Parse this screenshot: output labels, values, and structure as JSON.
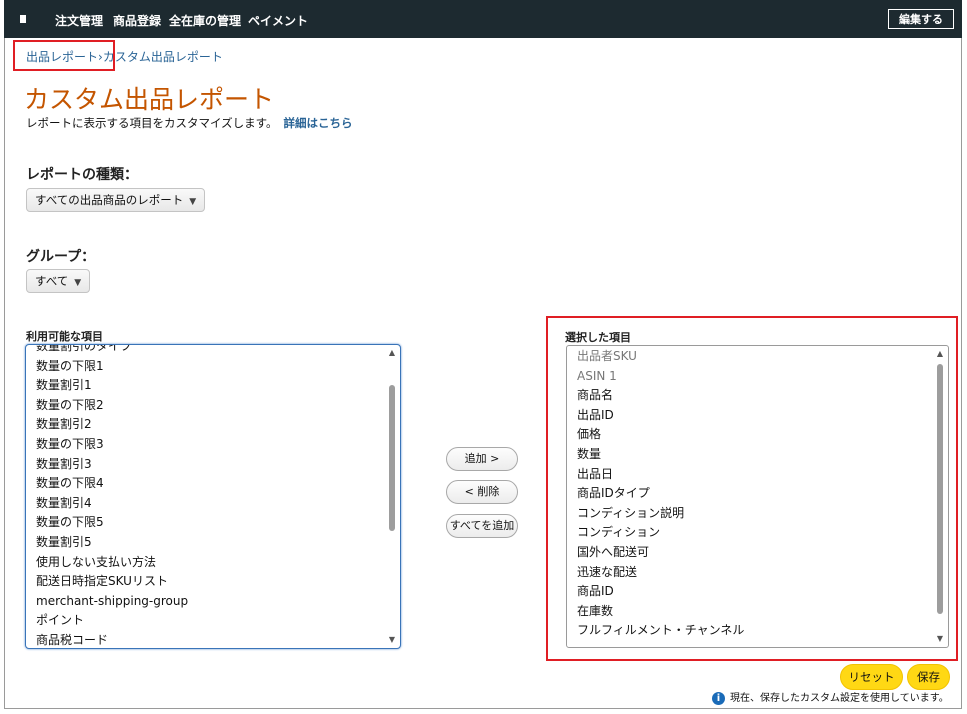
{
  "nav": {
    "items": [
      "注文管理",
      "商品登録",
      "全在庫の管理",
      "ペイメント"
    ],
    "edit_label": "編集する"
  },
  "breadcrumb": {
    "part1": "出品レポート",
    "separator": "›",
    "part2": "カスタム出品レポート"
  },
  "page": {
    "title": "カスタム出品レポート",
    "subtitle": "レポートに表示する項目をカスタマイズします。",
    "details_link": "詳細はこちら"
  },
  "report_type": {
    "label": "レポートの種類：",
    "selected": "すべての出品商品のレポート"
  },
  "group": {
    "label": "グループ：",
    "selected": "すべて"
  },
  "available": {
    "label": "利用可能な項目",
    "items": [
      "数量割引のタイプ",
      "数量の下限1",
      "数量割引1",
      "数量の下限2",
      "数量割引2",
      "数量の下限3",
      "数量割引3",
      "数量の下限4",
      "数量割引4",
      "数量の下限5",
      "数量割引5",
      "使用しない支払い方法",
      "配送日時指定SKUリスト",
      "merchant-shipping-group",
      "ポイント",
      "商品税コード"
    ]
  },
  "buttons": {
    "add": "追加 >",
    "remove": "< 削除",
    "add_all": "すべてを追加"
  },
  "selected": {
    "label": "選択した項目",
    "items": [
      {
        "text": "出品者SKU",
        "muted": true
      },
      {
        "text": "ASIN 1",
        "muted": true
      },
      {
        "text": "商品名",
        "muted": false
      },
      {
        "text": "出品ID",
        "muted": false
      },
      {
        "text": "価格",
        "muted": false
      },
      {
        "text": "数量",
        "muted": false
      },
      {
        "text": "出品日",
        "muted": false
      },
      {
        "text": "商品IDタイプ",
        "muted": false
      },
      {
        "text": "コンディション説明",
        "muted": false
      },
      {
        "text": "コンディション",
        "muted": false
      },
      {
        "text": "国外へ配送可",
        "muted": false
      },
      {
        "text": "迅速な配送",
        "muted": false
      },
      {
        "text": "商品ID",
        "muted": false
      },
      {
        "text": "在庫数",
        "muted": false
      },
      {
        "text": "フルフィルメント・チャンネル",
        "muted": false
      }
    ]
  },
  "actions": {
    "reset": "リセット",
    "save": "保存"
  },
  "status": {
    "text": "現在、保存したカスタム設定を使用しています。"
  },
  "colors": {
    "nav_bg": "#1d2a30",
    "title": "#c45500",
    "link": "#2a6496",
    "highlight": "#e01e24",
    "primary_button": "#ffd814"
  }
}
